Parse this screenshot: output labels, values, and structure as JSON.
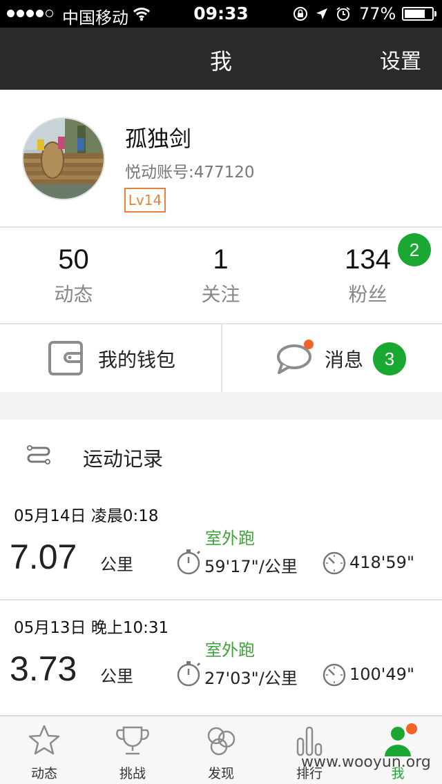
{
  "status_bar": {
    "carrier": "中国移动",
    "time": "09:33",
    "battery": "77%",
    "battery_level": 0.77
  },
  "nav": {
    "title": "我",
    "settings_label": "设置"
  },
  "profile": {
    "name": "孤独剑",
    "account": "悦动账号:477120",
    "level": "Lv14"
  },
  "stats": [
    {
      "value": "50",
      "label": "动态"
    },
    {
      "value": "1",
      "label": "关注"
    },
    {
      "value": "134",
      "label": "粉丝",
      "badge": "2"
    }
  ],
  "actions": {
    "wallet_label": "我的钱包",
    "message_label": "消息",
    "message_badge": "3"
  },
  "records": {
    "title": "运动记录",
    "items": [
      {
        "date": "05月14日  凌晨0:18",
        "type": "室外跑",
        "distance": "7.07",
        "unit": "公里",
        "pace": "59'17\"/公里",
        "duration": "418'59\""
      },
      {
        "date": "05月13日  晚上10:31",
        "type": "室外跑",
        "distance": "3.73",
        "unit": "公里",
        "pace": "27'03\"/公里",
        "duration": "100'49\""
      }
    ]
  },
  "tabs": [
    {
      "label": "动态",
      "icon": "star-icon"
    },
    {
      "label": "挑战",
      "icon": "trophy-icon"
    },
    {
      "label": "发现",
      "icon": "circles-icon"
    },
    {
      "label": "排行",
      "icon": "bar-chart-icon"
    },
    {
      "label": "我",
      "icon": "person-icon",
      "active": true
    }
  ],
  "watermark": "www.wooyun.org",
  "colors": {
    "accent_green": "#1aa832",
    "record_type_green": "#3fa33a",
    "level_orange": "#e8823a",
    "notification_red": "#f2632a",
    "nav_background": "#2a2a2a"
  }
}
